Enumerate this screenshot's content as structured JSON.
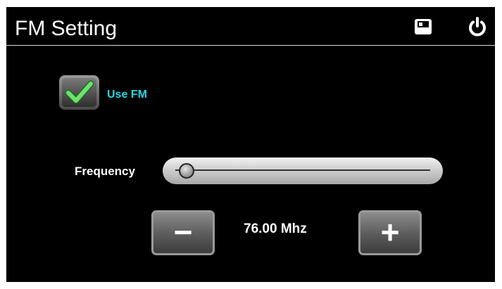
{
  "header": {
    "title": "FM Setting",
    "save_icon": "save-icon",
    "power_icon": "power-icon"
  },
  "use_fm": {
    "label": "Use FM",
    "checked": true,
    "check_icon": "checkmark-icon",
    "label_color": "#22d8e8"
  },
  "frequency": {
    "label": "Frequency",
    "value_text": "76.00 Mhz",
    "slider_fraction": 0.0,
    "minus_label": "−",
    "plus_label": "+"
  }
}
